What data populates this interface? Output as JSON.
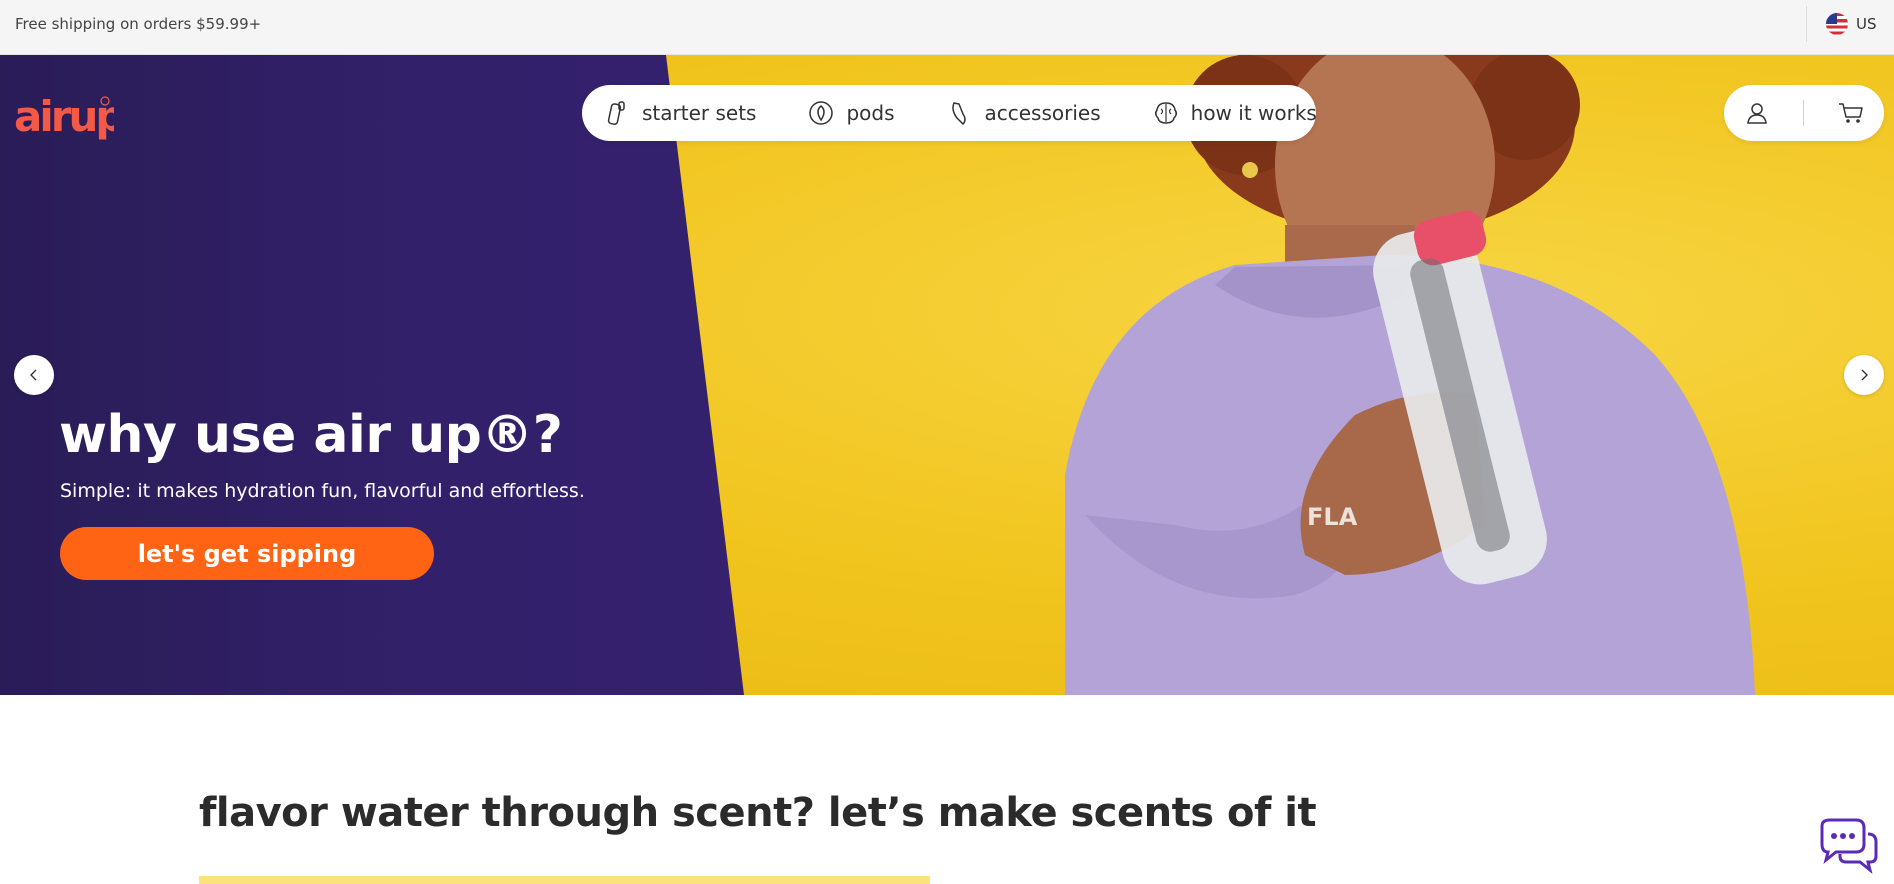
{
  "topbar": {
    "shipping_text": "Free shipping on orders $59.99+",
    "region_code": "US",
    "region_icon": "us-flag-icon"
  },
  "header": {
    "logo_text": "airup",
    "nav": [
      {
        "label": "starter sets",
        "icon": "bottle-icon"
      },
      {
        "label": "pods",
        "icon": "pod-icon"
      },
      {
        "label": "accessories",
        "icon": "strap-icon"
      },
      {
        "label": "how it works",
        "icon": "brain-icon"
      }
    ],
    "account_icon": "user-icon",
    "cart_icon": "cart-icon"
  },
  "hero": {
    "title": "why use air up®?",
    "subtitle": "Simple: it makes hydration fun, flavorful and effortless.",
    "cta_label": "let's get sipping",
    "prev_icon": "chevron-left-icon",
    "next_icon": "chevron-right-icon"
  },
  "section": {
    "title": "flavor water through scent? let’s make scents of it"
  },
  "chat": {
    "icon": "chat-bubbles-icon"
  },
  "colors": {
    "brand_orange": "#ff6314",
    "logo_coral": "#f25a47",
    "hero_purple": "#32206a",
    "hero_yellow": "#f2c724",
    "chat_purple": "#5b2bb7"
  }
}
